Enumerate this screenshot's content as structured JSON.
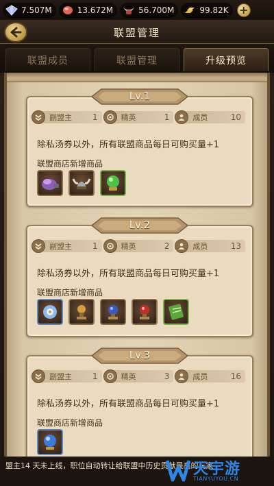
{
  "resources": [
    {
      "icon": "gem-icon",
      "value": "7.507M"
    },
    {
      "icon": "meat-icon",
      "value": "13.672M"
    },
    {
      "icon": "horn-helmet-icon",
      "value": "56.700M"
    },
    {
      "icon": "gold-bars-icon",
      "value": "99.82K"
    }
  ],
  "header": {
    "title": "联盟管理"
  },
  "tabs": [
    {
      "label": "联盟成员",
      "active": false
    },
    {
      "label": "联盟管理",
      "active": false
    },
    {
      "label": "升级预览",
      "active": true
    }
  ],
  "levels": [
    {
      "level": "Lv.1",
      "stats": [
        {
          "label": "副盟主",
          "value": "1"
        },
        {
          "label": "精英",
          "value": "1"
        },
        {
          "label": "成员",
          "value": "10"
        }
      ],
      "description": "除私汤券以外，所有联盟商品每日可购买量",
      "bonus": "+1",
      "shop_title": "联盟商店新增商品",
      "items": [
        "purple-beetle-icon",
        "viking-helmet-icon",
        "green-orb-icon"
      ]
    },
    {
      "level": "Lv.2",
      "stats": [
        {
          "label": "副盟主",
          "value": "1"
        },
        {
          "label": "精英",
          "value": "2"
        },
        {
          "label": "成员",
          "value": "13"
        }
      ],
      "description": "除私汤券以外，所有联盟商品每日可购买量",
      "bonus": "+1",
      "shop_title": "联盟商店新增商品",
      "items": [
        "gear-ornament-icon",
        "bronze-trophy-icon",
        "blue-orb-icon",
        "red-orb-icon",
        "green-scroll-icon"
      ]
    },
    {
      "level": "Lv.3",
      "stats": [
        {
          "label": "副盟主",
          "value": "1"
        },
        {
          "label": "精英",
          "value": "3"
        },
        {
          "label": "成员",
          "value": "16"
        }
      ],
      "description": "除私汤券以外，所有联盟商品每日可购买量",
      "bonus": "+1",
      "shop_title": "联盟商店新增商品",
      "items": [
        "blue-globe-icon"
      ]
    }
  ],
  "notice": "盟主14 天未上线，职位自动转让给联盟中历史贡献最高的玩家",
  "watermark": {
    "title": "天宇游",
    "url": "TIANYUYOU.CN"
  }
}
